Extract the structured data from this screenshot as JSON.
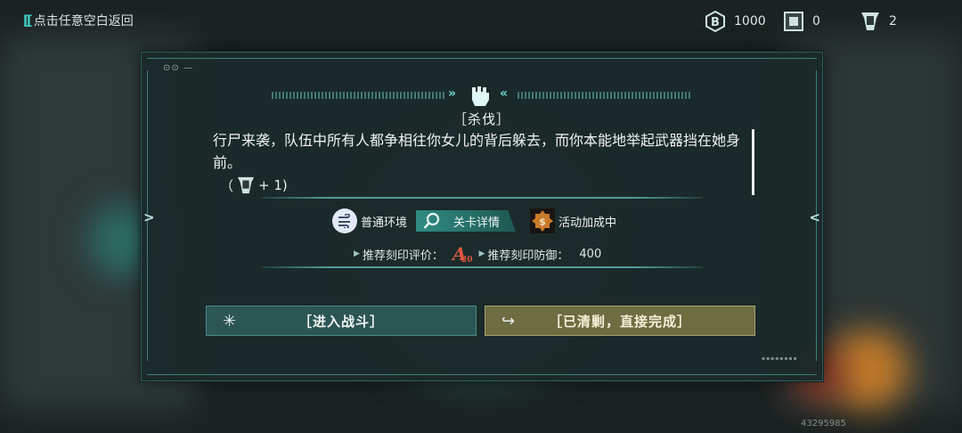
{
  "topbar": {
    "back_label": "点击任意空白返回",
    "currencies": [
      {
        "icon": "coin-b-icon",
        "value": "1000"
      },
      {
        "icon": "chip-card-icon",
        "value": "0"
      },
      {
        "icon": "emblem-ticket-icon",
        "value": "2"
      }
    ]
  },
  "dialog": {
    "title": "［杀伐］",
    "description": "行尸来袭，队伍中所有人都争相往你女儿的背后躲去，而你本能地举起武器挡在她身前。",
    "reward": {
      "open": "（",
      "amount": "+ 1)"
    },
    "environment_label": "普通环境",
    "detail_tab_label": "关卡详情",
    "event_label": "活动加成中",
    "recommend_rating_label": "推荐刻印评价：",
    "recommend_grade": "A",
    "recommend_grade_sub": "20",
    "recommend_defense_label": "推荐刻印防御：",
    "recommend_defense_value": "400",
    "enter_battle_label": "［进入战斗］",
    "sweep_label": "［已清剿，直接完成］",
    "dots": "⊙⊙ —",
    "tiny_code": "▪▪▪▪▪▪▪▪"
  },
  "footer": {
    "uid": "43295985"
  },
  "colors": {
    "accent": "#41c8bd",
    "panel": "#1b2929",
    "battle_button": "#2c5654",
    "sweep_button": "#6e6c41",
    "grade": "#e05840"
  }
}
